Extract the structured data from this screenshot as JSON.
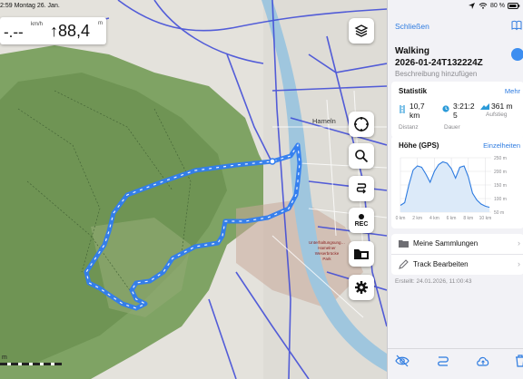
{
  "status": {
    "time": "2:59",
    "date": "Montag 26. Jan.",
    "battery": "80 %"
  },
  "speed": {
    "value": "-.--",
    "unit": "km/h"
  },
  "altitude": {
    "value": "↑88,4",
    "unit": "m"
  },
  "map": {
    "city_label": "Hameln",
    "poi_label": [
      "Unterhaltungsung…",
      "Hamelner",
      "Weserbrücke",
      "Park"
    ],
    "scale": "m"
  },
  "map_buttons": [
    "layers-icon",
    "compass-icon",
    "search-icon",
    "route-icon",
    "rec-icon",
    "map-folder-icon",
    "settings-icon"
  ],
  "rec_label": "REC",
  "panel": {
    "close": "Schließen",
    "activity": "Walking",
    "track_name": "2026-01-24T132224Z",
    "description_placeholder": "Beschreibung hinzufügen",
    "statistics": {
      "title": "Statistik",
      "more": "Mehr",
      "distance": {
        "value": "10,7",
        "unit": "km",
        "label": "Distanz"
      },
      "duration": {
        "value": "3:21:2",
        "value2": "5",
        "label": "Dauer"
      },
      "ascent": {
        "value": "361 m",
        "label": "Aufstieg"
      }
    },
    "elevation": {
      "title": "Höhe (GPS)",
      "details": "Einzelheiten"
    },
    "menu": [
      {
        "label": "Meine Sammlungen",
        "icon": "folder-icon"
      },
      {
        "label": "Track Bearbeiten",
        "icon": "pencil-icon"
      }
    ],
    "created": "Erstellt: 24.01.2026, 11:00:43"
  },
  "chart_data": {
    "type": "area",
    "title": "Höhe (GPS)",
    "x": [
      0,
      0.5,
      1,
      1.5,
      2,
      2.5,
      3,
      3.5,
      4,
      4.5,
      5,
      5.5,
      6,
      6.5,
      7,
      7.5,
      8,
      8.5,
      9,
      9.5,
      10,
      10.5
    ],
    "values": [
      75,
      85,
      150,
      205,
      220,
      215,
      190,
      160,
      200,
      225,
      235,
      230,
      210,
      175,
      215,
      220,
      180,
      120,
      95,
      80,
      72,
      68
    ],
    "xlabel": "",
    "ylabel": "",
    "x_ticks": [
      "0 km",
      "2 km",
      "4 km",
      "6 km",
      "8 km",
      "10 km"
    ],
    "y_ticks": [
      "250 m",
      "200 m",
      "150 m",
      "100 m",
      "50 m"
    ],
    "xlim": [
      0,
      10.7
    ],
    "ylim": [
      50,
      250
    ],
    "grid": true
  }
}
